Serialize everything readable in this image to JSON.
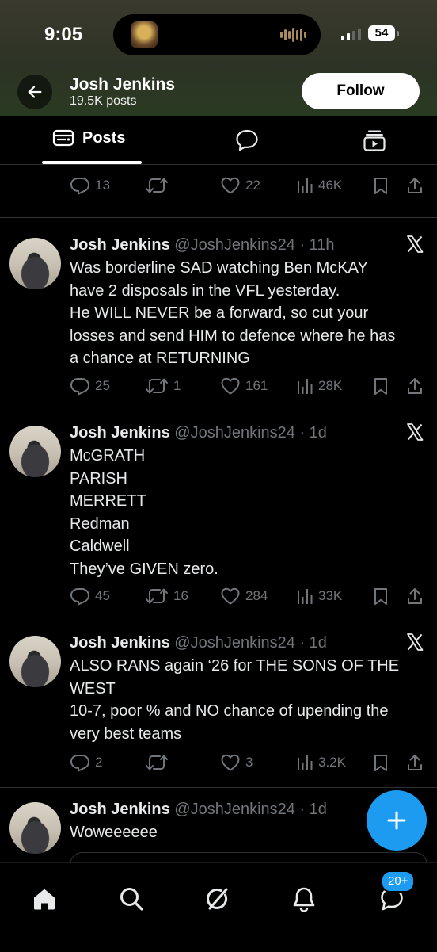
{
  "status_bar": {
    "time": "9:05",
    "battery": "54"
  },
  "profile": {
    "name": "Josh Jenkins",
    "posts_count": "19.5K posts",
    "follow_label": "Follow"
  },
  "tabs": {
    "posts_label": "Posts"
  },
  "partial_tweet": {
    "replies": "13",
    "retweets": "",
    "likes": "22",
    "views": "46K"
  },
  "tweets": [
    {
      "name": "Josh Jenkins",
      "meta": "@JoshJenkins24 · 11h",
      "lines": [
        "Was borderline SAD watching Ben McKAY",
        "have 2 disposals in the VFL yesterday.",
        "He WILL NEVER be a forward, so cut your",
        "losses and send HIM to defence where he has",
        "a chance at RETURNING"
      ],
      "replies": "25",
      "retweets": "1",
      "likes": "161",
      "views": "28K"
    },
    {
      "name": "Josh Jenkins",
      "meta": "@JoshJenkins24 · 1d",
      "lines": [
        "McGRATH",
        "PARISH",
        "MERRETT",
        "Redman",
        "Caldwell",
        "They’ve GIVEN zero."
      ],
      "replies": "45",
      "retweets": "16",
      "likes": "284",
      "views": "33K"
    },
    {
      "name": "Josh Jenkins",
      "meta": "@JoshJenkins24 · 1d",
      "lines": [
        "ALSO RANS again ‘26 for THE SONS OF THE",
        "WEST",
        "10-7, poor % and NO chance of upending the",
        "very best teams"
      ],
      "replies": "2",
      "retweets": "",
      "likes": "3",
      "views": "3.2K"
    },
    {
      "name": "Josh Jenkins",
      "meta": "@JoshJenkins24 · 1d",
      "lines": [
        "Woweeeeee"
      ]
    }
  ],
  "bottom_nav": {
    "messages_badge": "20+"
  },
  "colors": {
    "background": "#000000",
    "text_primary": "#e7e9ea",
    "text_secondary": "#71767b",
    "accent": "#1d9bf0",
    "divider": "#2f3336"
  },
  "icons": {
    "back": "arrow-left-icon",
    "posts_tab": "posts-tab-icon",
    "replies_tab": "speech-bubble-icon",
    "media_tab": "media-tab-icon",
    "reply": "reply-icon",
    "retweet": "retweet-icon",
    "like": "heart-icon",
    "views": "views-icon",
    "bookmark": "bookmark-icon",
    "share": "share-icon",
    "x_logo": "x-logo-icon",
    "compose": "plus-icon",
    "home": "home-icon",
    "search": "search-icon",
    "grok": "grok-icon",
    "notifications": "bell-icon",
    "messages": "messages-icon"
  }
}
